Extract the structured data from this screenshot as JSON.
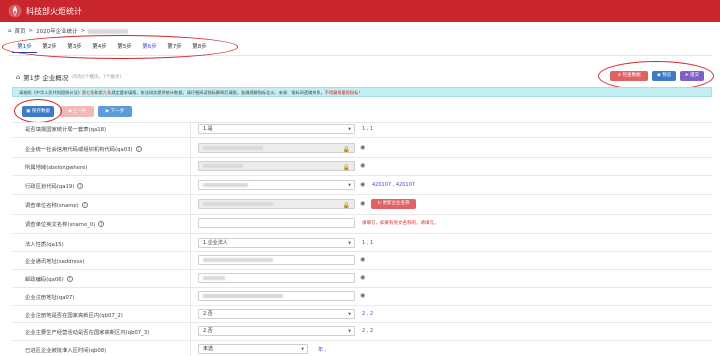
{
  "header": {
    "app_title": "科技部火炬统计"
  },
  "breadcrumb": {
    "home": "首页",
    "sep": ">",
    "item": "2020年企业统计",
    "sep2": ">"
  },
  "steps": [
    {
      "label": "第1步"
    },
    {
      "label": "第2步"
    },
    {
      "label": "第3步"
    },
    {
      "label": "第4步"
    },
    {
      "label": "第5步"
    },
    {
      "label": "第6步"
    },
    {
      "label": "第7步"
    },
    {
      "label": "第8步"
    }
  ],
  "panel": {
    "title": "第1步 企业概况",
    "hint": "(均为5个模块，7个接点)",
    "buttons": {
      "check": "检查数据",
      "preview": "预览",
      "submit": "提交"
    }
  },
  "notice": {
    "text_a": "请按照《中华人民共和国统计法》",
    "text_b": "第七条",
    "text_c": "和",
    "text_d": "第九条",
    "text_e": "规定要求填报，依法如实提供统计数据，请仔细阅读指标解释后填报，准确理解指标含义、来源、指标间逻辑关系，",
    "text_f": "不得漏报重报指标！"
  },
  "actions": {
    "save": "保存数据",
    "prev": "上一步",
    "next": "下一步"
  },
  "fields": {
    "qa18": {
      "label": "是否填报国家统计局一套表(qa18)",
      "value": "1.是",
      "code": "1 , 1"
    },
    "qa03": {
      "label": "企业统一社会信用代码或组织机构代码(qa03)"
    },
    "belong": {
      "label": "所属地域(sbelongwhere)"
    },
    "qa19": {
      "label": "行政区划代码(qa19)",
      "code": "420107 , 420107"
    },
    "sname": {
      "label": "调查单位名称(sname)",
      "action": "更新企业名称"
    },
    "sname0": {
      "label": "调查单位英文名称(sname_0)",
      "error": "请填写，如果有英文名称的，请填写。"
    },
    "qa15": {
      "label": "法人性质(qa15)",
      "value": "1.企业法人",
      "code": "1 , 1"
    },
    "saddress": {
      "label": "企业通讯地址(saddress)"
    },
    "qa06": {
      "label": "邮政编码(qa06)"
    },
    "qa07": {
      "label": "企业注册地址(qa07)"
    },
    "qb07_2": {
      "label": "企业注册地是否在国家高新区内(qb07_2)",
      "value": "2.否",
      "code": "2 , 2"
    },
    "qb07_3": {
      "label": "企业主要生产经营活动是否在国家高新区内(qb07_3)",
      "value": "2.否",
      "code": "2 , 2"
    },
    "qb08": {
      "label": "已进区企业被批准入区时间(qb08)",
      "value": "未选",
      "code": "年 ,"
    }
  },
  "colors": {
    "brand": "#c8252c",
    "accent": "#1f4aa8",
    "highlight": "#d02a2f"
  }
}
